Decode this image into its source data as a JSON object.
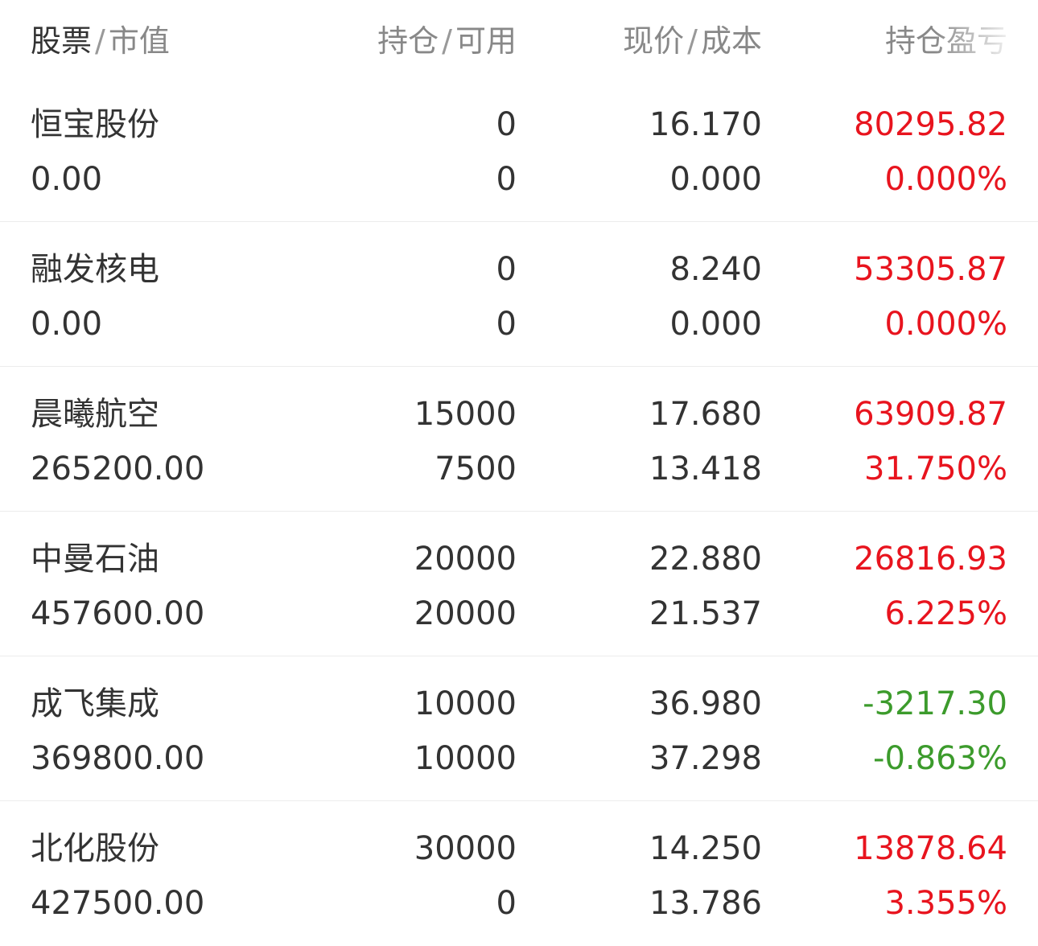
{
  "header": {
    "col1_main": "股票",
    "col1_sub": "市值",
    "col2_main": "持仓",
    "col2_sub": "可用",
    "col3_main": "现价",
    "col3_sub": "成本",
    "col4": "持仓盈亏",
    "separator": "/"
  },
  "colors": {
    "profit": "#e8141e",
    "loss": "#3c9b2c",
    "text": "#333333",
    "header_text": "#888888"
  },
  "rows": [
    {
      "name": "恒宝股份",
      "market_value": "0.00",
      "position": "0",
      "available": "0",
      "price": "16.170",
      "cost": "0.000",
      "pnl": "80295.82",
      "pnl_pct": "0.000%",
      "trend": "up"
    },
    {
      "name": "融发核电",
      "market_value": "0.00",
      "position": "0",
      "available": "0",
      "price": "8.240",
      "cost": "0.000",
      "pnl": "53305.87",
      "pnl_pct": "0.000%",
      "trend": "up"
    },
    {
      "name": "晨曦航空",
      "market_value": "265200.00",
      "position": "15000",
      "available": "7500",
      "price": "17.680",
      "cost": "13.418",
      "pnl": "63909.87",
      "pnl_pct": "31.750%",
      "trend": "up"
    },
    {
      "name": "中曼石油",
      "market_value": "457600.00",
      "position": "20000",
      "available": "20000",
      "price": "22.880",
      "cost": "21.537",
      "pnl": "26816.93",
      "pnl_pct": "6.225%",
      "trend": "up"
    },
    {
      "name": "成飞集成",
      "market_value": "369800.00",
      "position": "10000",
      "available": "10000",
      "price": "36.980",
      "cost": "37.298",
      "pnl": "-3217.30",
      "pnl_pct": "-0.863%",
      "trend": "down"
    },
    {
      "name": "北化股份",
      "market_value": "427500.00",
      "position": "30000",
      "available": "0",
      "price": "14.250",
      "cost": "13.786",
      "pnl": "13878.64",
      "pnl_pct": "3.355%",
      "trend": "up"
    }
  ]
}
